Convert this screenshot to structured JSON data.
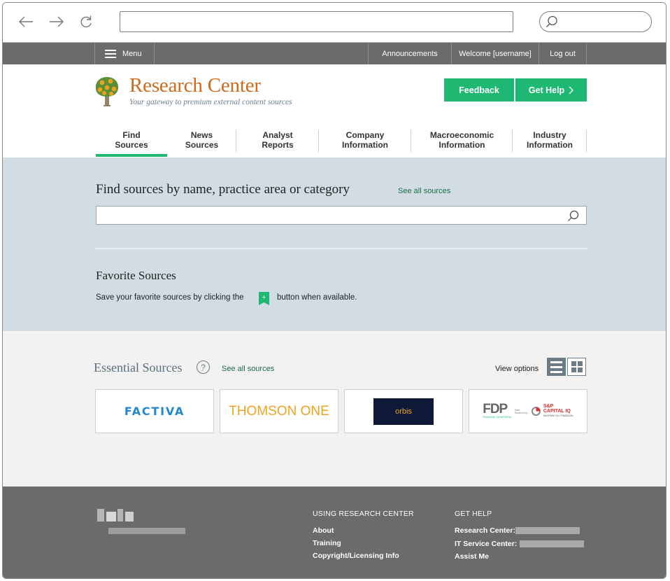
{
  "browser": {
    "url": "",
    "search_placeholder": ""
  },
  "topbar": {
    "menu_label": "Menu",
    "announcements": "Announcements",
    "welcome": "Welcome [username]",
    "logout": "Log out"
  },
  "header": {
    "title": "Research Center",
    "tagline": "Your gateway to premium external content sources",
    "feedback_label": "Feedback",
    "get_help_label": "Get Help"
  },
  "tabs": [
    {
      "line1": "Find",
      "line2": "Sources",
      "active": true
    },
    {
      "line1": "News",
      "line2": "Sources",
      "active": false
    },
    {
      "line1": "Analyst",
      "line2": "Reports",
      "active": false
    },
    {
      "line1": "Company",
      "line2": "Information",
      "active": false
    },
    {
      "line1": "Macroeconomic",
      "line2": "Information",
      "active": false
    },
    {
      "line1": "Industry",
      "line2": "Information",
      "active": false
    }
  ],
  "search": {
    "title": "Find sources by name, practice area or category",
    "see_all": "See all sources",
    "value": "",
    "placeholder": ""
  },
  "favorites": {
    "title": "Favorite Sources",
    "text_before": "Save your favorite sources by clicking  the",
    "plus_glyph": "+",
    "text_after": "button when available."
  },
  "essential": {
    "title": "Essential Sources",
    "help_glyph": "?",
    "see_all": "See all sources",
    "view_options_label": "View options",
    "sources": [
      {
        "name": "FACTIVA"
      },
      {
        "name": "THOMSON ONE"
      },
      {
        "name": "orbis"
      },
      {
        "name": "FDP",
        "caption": "FINANCIAL DATAPORTAL",
        "powered": "Data Powered by",
        "partner": "S&P",
        "partner2": "CAPITAL IQ",
        "partner3": "McGRAW HILL FINANCIAL"
      }
    ]
  },
  "footer": {
    "col1_heading": "USING RESEARCH CENTER",
    "col1_links": [
      "About",
      "Training",
      "Copyright/Licensing Info"
    ],
    "col2_heading": "GET HELP",
    "col2_links": [
      "Research Center:",
      "IT Service Center:",
      "Assist Me"
    ]
  },
  "colors": {
    "accent_green": "#1fb872",
    "brand_orange": "#d06a1b",
    "topbar_gray": "#6b6b6b",
    "panel_blue": "#d1dde2"
  },
  "icons": [
    "back-arrow-icon",
    "forward-arrow-icon",
    "reload-icon",
    "search-icon",
    "hamburger-icon",
    "tree-logo-icon",
    "chevron-right-icon",
    "help-icon",
    "list-view-icon",
    "grid-view-icon",
    "plus-icon"
  ]
}
